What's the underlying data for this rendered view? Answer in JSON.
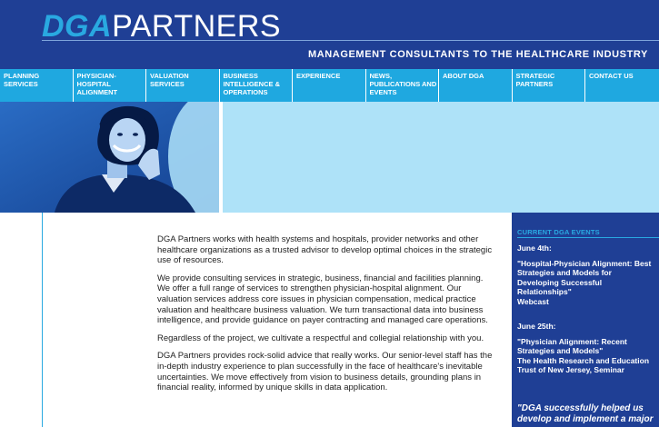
{
  "brand": {
    "logo_dga": "DGA",
    "logo_partners": "PARTNERS",
    "tagline": "MANAGEMENT CONSULTANTS TO THE HEALTHCARE INDUSTRY"
  },
  "nav": [
    "PLANNING SERVICES",
    "PHYSICIAN-HOSPITAL ALIGNMENT",
    "VALUATION SERVICES",
    "BUSINESS INTELLIGENCE & OPERATIONS",
    "EXPERIENCE",
    "NEWS, PUBLICATIONS AND EVENTS",
    "ABOUT DGA",
    "STRATEGIC PARTNERS",
    "CONTACT US"
  ],
  "main": {
    "p1": "DGA Partners works with health systems and hospitals, provider networks and other healthcare organizations as a trusted advisor to develop optimal choices in the strategic use of resources.",
    "p2": "We provide consulting services in strategic, business, financial and facilities planning. We offer a full range of services to strengthen physician-hospital alignment. Our valuation services address core issues in physician compensation, medical practice valuation and healthcare business valuation. We turn transactional data into business intelligence, and provide guidance on payer contracting and managed care operations.",
    "p3": "Regardless of the project, we cultivate a respectful and collegial relationship with you.",
    "p4": "DGA Partners provides rock-solid advice that really works. Our senior-level staff has the in-depth industry experience to plan successfully in the face of healthcare's inevitable uncertainties. We move effectively from vision to business details, grounding plans in financial reality, informed by unique skills in data application."
  },
  "events": {
    "title": "CURRENT DGA EVENTS",
    "items": [
      {
        "date": "June 4th:",
        "title": "\"Hospital-Physician Alignment: Best Strategies and Models for Developing Successful Relationships\"",
        "location": "Webcast"
      },
      {
        "date": "June 25th:",
        "title": "\"Physician Alignment: Recent Strategies and Models\"",
        "location": "The Health Research and Education Trust of New Jersey, Seminar"
      }
    ],
    "quote": "\"DGA successfully helped us develop and implement a major"
  },
  "colors": {
    "navy": "#1f3f95",
    "cyan": "#1fa8e0",
    "light_cyan": "#aee2f8"
  }
}
